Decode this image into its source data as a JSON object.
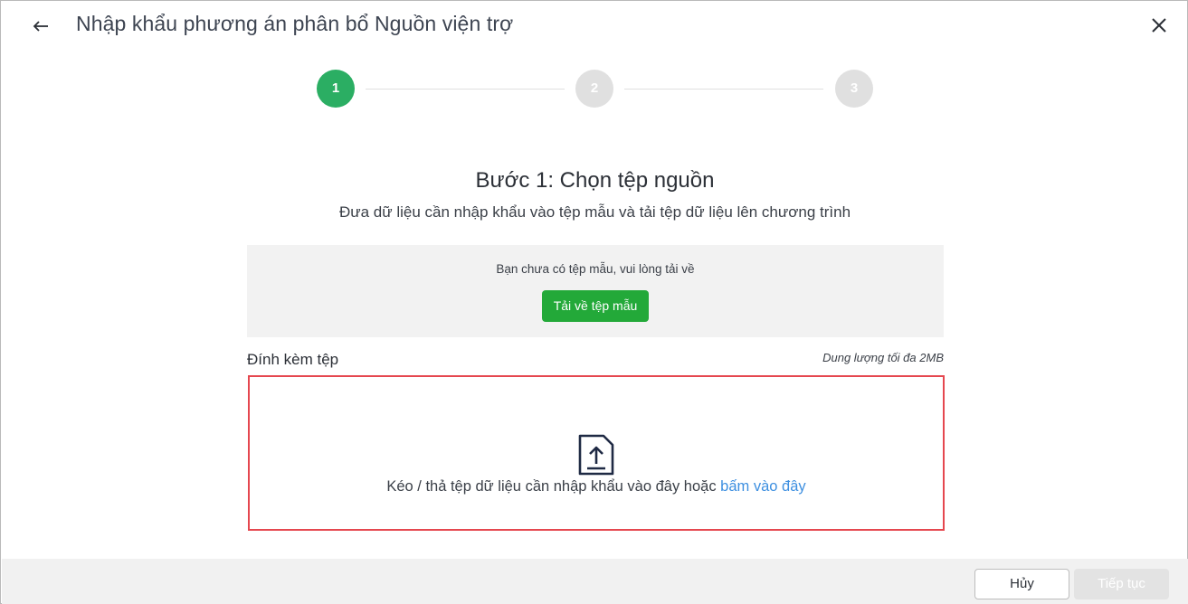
{
  "header": {
    "title": "Nhập khẩu phương án phân bổ Nguồn viện trợ",
    "back_icon": "arrow-left-icon",
    "close_icon": "close-icon"
  },
  "stepper": {
    "steps": [
      {
        "label": "1",
        "state": "active",
        "color": "#2bae63"
      },
      {
        "label": "2",
        "state": "inactive",
        "color": "#e0e0e0"
      },
      {
        "label": "3",
        "state": "inactive",
        "color": "#e0e0e0"
      }
    ]
  },
  "step": {
    "heading": "Bước 1: Chọn tệp nguồn",
    "description": "Đưa dữ liệu cần nhập khẩu vào tệp mẫu và tải tệp dữ liệu lên chương trình"
  },
  "template": {
    "prompt": "Bạn chưa có tệp mẫu, vui lòng tải về",
    "download_label": "Tải về tệp mẫu",
    "button_color": "#23a939"
  },
  "attachment": {
    "label": "Đính kèm tệp",
    "size_note": "Dung lượng tối đa 2MB",
    "drop_text": "Kéo / thả tệp dữ liệu cần nhập khẩu vào đây hoặc ",
    "drop_link": "bấm vào đây",
    "upload_icon": "file-upload-icon",
    "border_color": "#e5474f"
  },
  "footer": {
    "cancel_label": "Hủy",
    "next_label": "Tiếp tục"
  }
}
